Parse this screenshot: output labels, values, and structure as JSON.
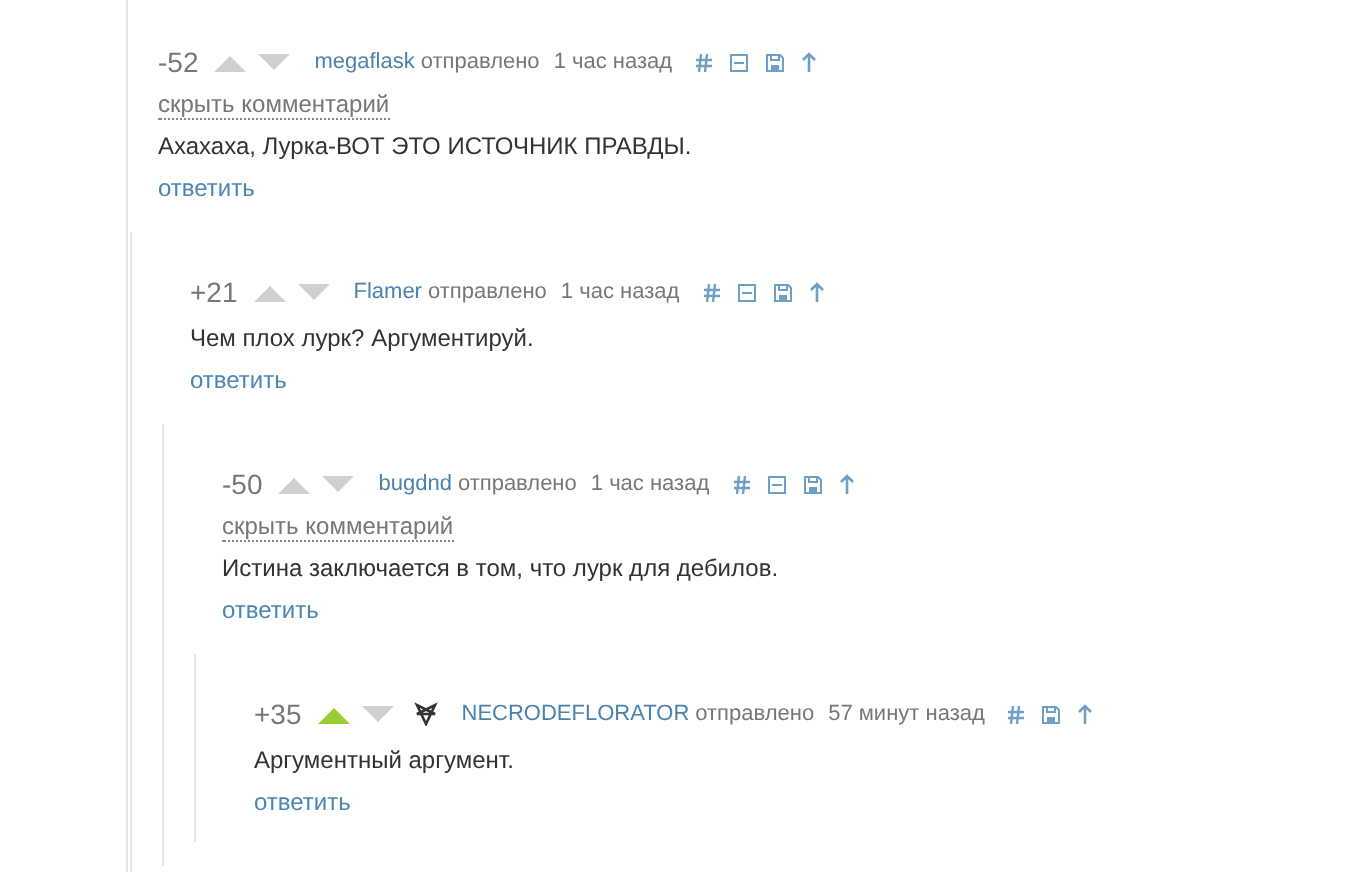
{
  "comments": [
    {
      "rating": "-52",
      "upvoted": false,
      "author": "megaflask",
      "posted": "отправлено",
      "time": "1 час назад",
      "collapsible": true,
      "badge": false,
      "hide_link": "скрыть комментарий",
      "text": "Ахахаха, Лурка-ВОТ ЭТО ИСТОЧНИК ПРАВДЫ.",
      "reply": "ответить",
      "children": [
        {
          "rating": "+21",
          "upvoted": false,
          "author": "Flamer",
          "posted": "отправлено",
          "time": "1 час назад",
          "collapsible": true,
          "badge": false,
          "text": "Чем плох лурк? Аргументируй.",
          "reply": "ответить",
          "children": [
            {
              "rating": "-50",
              "upvoted": false,
              "author": "bugdnd",
              "posted": "отправлено",
              "time": "1 час назад",
              "collapsible": true,
              "badge": false,
              "hide_link": "скрыть комментарий",
              "text": "Истина заключается в том, что лурк для дебилов.",
              "reply": "ответить",
              "children": [
                {
                  "rating": "+35",
                  "upvoted": true,
                  "author": "NECRODEFLORATOR",
                  "posted": "отправлено",
                  "time": "57 минут назад",
                  "collapsible": false,
                  "badge": true,
                  "text": "Аргументный аргумент.",
                  "reply": "ответить"
                }
              ]
            }
          ]
        }
      ]
    }
  ]
}
